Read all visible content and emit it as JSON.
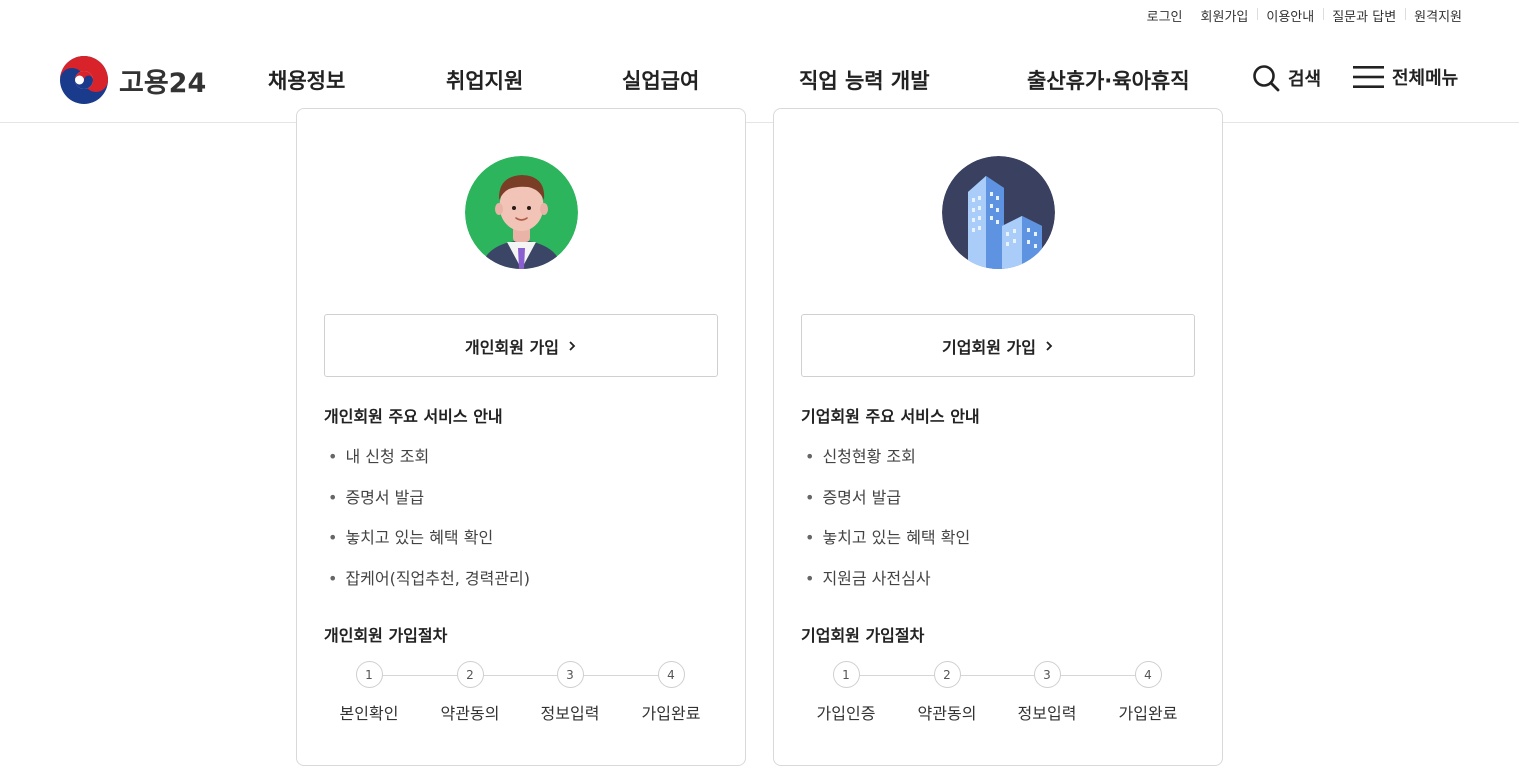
{
  "util_links": [
    "로그인",
    "회원가입",
    "이용안내",
    "질문과 답변",
    "원격지원"
  ],
  "logo": {
    "text": "고용24"
  },
  "nav": [
    "채용정보",
    "취업지원",
    "실업급여",
    "직업 능력 개발",
    "출산휴가·육아휴직"
  ],
  "header_buttons": {
    "search": "검색",
    "menu": "전체메뉴"
  },
  "personal": {
    "join_label": "개인회원 가입",
    "services_title": "개인회원 주요 서비스 안내",
    "services": [
      "내 신청 조회",
      "증명서 발급",
      "놓치고 있는 혜택 확인",
      "잡케어(직업추천, 경력관리)"
    ],
    "steps_title": "개인회원 가입절차",
    "steps": [
      {
        "num": "1",
        "label": "본인확인"
      },
      {
        "num": "2",
        "label": "약관동의"
      },
      {
        "num": "3",
        "label": "정보입력"
      },
      {
        "num": "4",
        "label": "가입완료"
      }
    ]
  },
  "corporate": {
    "join_label": "기업회원 가입",
    "services_title": "기업회원 주요 서비스 안내",
    "services": [
      "신청현황 조회",
      "증명서 발급",
      "놓치고 있는 혜택 확인",
      "지원금 사전심사"
    ],
    "steps_title": "기업회원 가입절차",
    "steps": [
      {
        "num": "1",
        "label": "가입인증"
      },
      {
        "num": "2",
        "label": "약관동의"
      },
      {
        "num": "3",
        "label": "정보입력"
      },
      {
        "num": "4",
        "label": "가입완료"
      }
    ]
  },
  "colors": {
    "personal_avatar_bg": "#2db55d",
    "corporate_avatar_bg": "#3a4160"
  }
}
